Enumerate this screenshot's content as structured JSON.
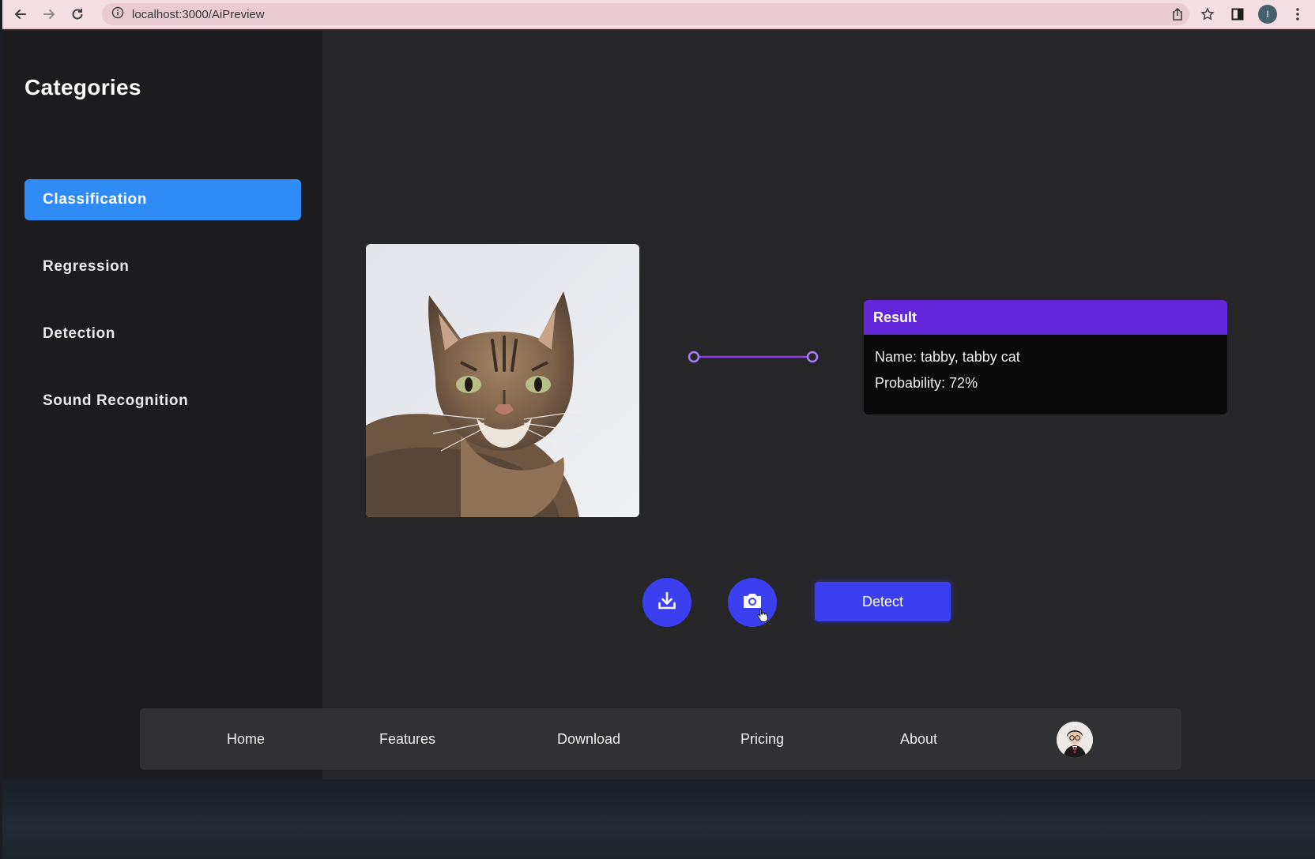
{
  "browser": {
    "url": "localhost:3000/AiPreview",
    "profile_initial": "I"
  },
  "sidebar": {
    "title": "Categories",
    "items": [
      {
        "label": "Classification",
        "active": true
      },
      {
        "label": "Regression",
        "active": false
      },
      {
        "label": "Detection",
        "active": false
      },
      {
        "label": "Sound Recognition",
        "active": false
      }
    ]
  },
  "result": {
    "header": "Result",
    "name_line": "Name: tabby, tabby cat",
    "probability_line": "Probability: 72%"
  },
  "actions": {
    "detect_label": "Detect"
  },
  "nav": {
    "items": [
      "Home",
      "Features",
      "Download",
      "Pricing",
      "About"
    ]
  },
  "colors": {
    "sidebar_active": "#2f8cf6",
    "result_header": "#6326d8",
    "primary_button": "#3b3fef",
    "connector": "#8b3ff0"
  },
  "icons": [
    "back-icon",
    "forward-icon",
    "reload-icon",
    "info-icon",
    "share-icon",
    "star-icon",
    "sidepanel-icon",
    "menu-dots-icon",
    "download-icon",
    "camera-icon",
    "pointer-cursor-icon"
  ]
}
